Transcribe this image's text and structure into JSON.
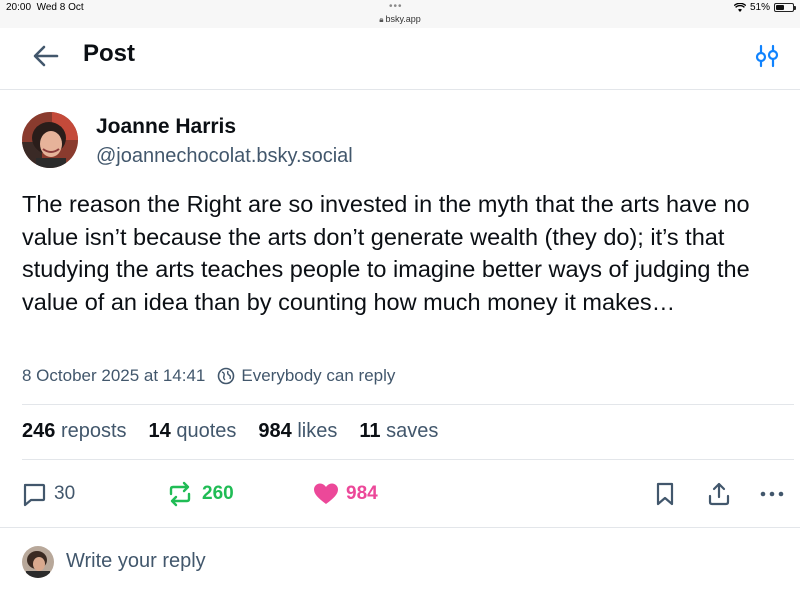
{
  "status_bar": {
    "time": "20:00",
    "date": "Wed 8 Oct",
    "url": "bsky.app",
    "battery": "51%",
    "battery_level": 0.51
  },
  "header": {
    "title": "Post"
  },
  "post": {
    "author_name": "Joanne Harris",
    "author_handle": "@joannechocolat.bsky.social",
    "text": "The reason the Right are so invested in the myth that the arts have no value isn’t because the arts don’t generate wealth (they do); it’s that studying the arts teaches people to imagine better ways of judging the value of an idea than by counting how much money it makes…",
    "timestamp": "8 October 2025 at 14:41",
    "reply_setting": "Everybody can reply"
  },
  "stats": {
    "reposts_count": "246",
    "reposts_label": "reposts",
    "quotes_count": "14",
    "quotes_label": "quotes",
    "likes_count": "984",
    "likes_label": "likes",
    "saves_count": "11",
    "saves_label": "saves"
  },
  "actions": {
    "reply_count": "30",
    "repost_count": "260",
    "like_count": "984",
    "icons": [
      "reply-bubble-icon",
      "repost-icon",
      "heart-icon",
      "bookmark-icon",
      "share-icon",
      "more-icon"
    ]
  },
  "composer": {
    "placeholder": "Write your reply"
  },
  "colors": {
    "text": "#0b0f14",
    "muted": "#42576c",
    "accent_blue": "#1083fe",
    "repost_green": "#20bc55",
    "like_pink": "#ec4899",
    "divider": "#e3e6ea"
  }
}
